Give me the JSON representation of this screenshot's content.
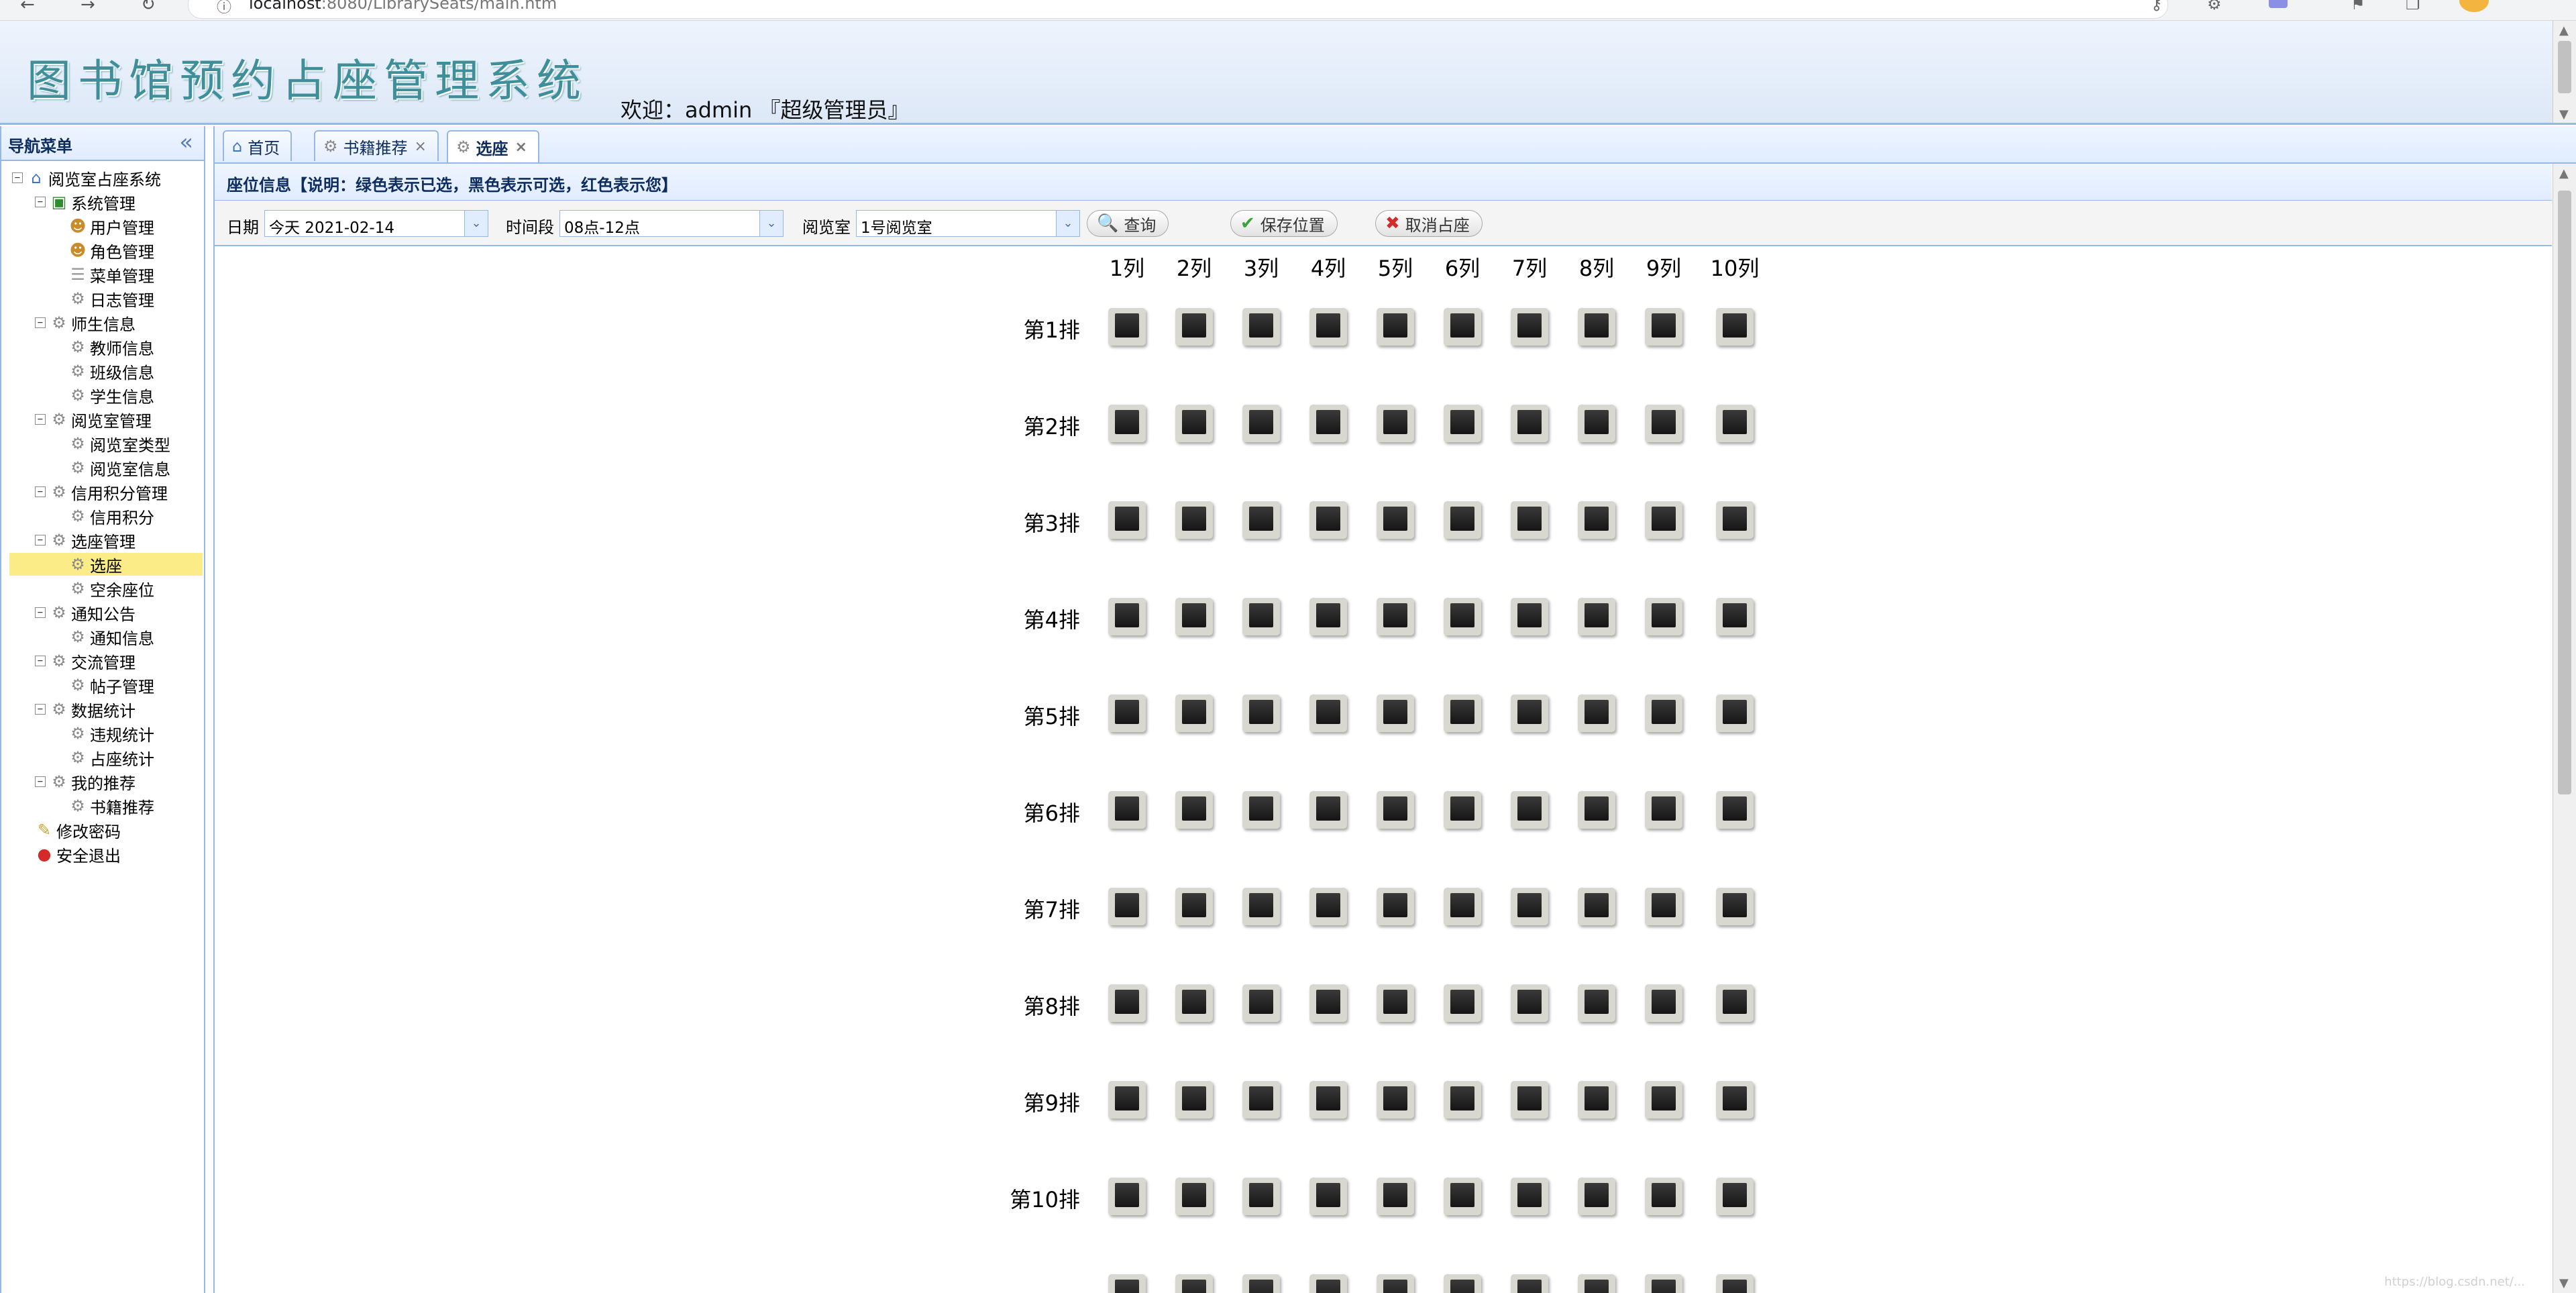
{
  "browser": {
    "back": "←",
    "forward": "→",
    "reload": "↻",
    "url_host": "localhost",
    "url_rest": ":8080/LibrarySeats/main.htm"
  },
  "header": {
    "title": "图书馆预约占座管理系统",
    "welcome": "欢迎：admin 『超级管理员』"
  },
  "sidebar": {
    "title": "导航菜单",
    "collapse_glyph": "«",
    "nodes": [
      {
        "label": "阅览室占座系统",
        "level": 0,
        "toggle": "⊟",
        "icon": "home-icon",
        "glyph": "⌂"
      },
      {
        "label": "系统管理",
        "level": 1,
        "toggle": "⊟",
        "icon": "system-icon",
        "glyph": "▣"
      },
      {
        "label": "用户管理",
        "level": 2,
        "icon": "user-icon",
        "glyph": "☻"
      },
      {
        "label": "角色管理",
        "level": 2,
        "icon": "role-icon",
        "glyph": "☻"
      },
      {
        "label": "菜单管理",
        "level": 2,
        "icon": "menu-icon",
        "glyph": "☰"
      },
      {
        "label": "日志管理",
        "level": 2,
        "icon": "gear-icon",
        "glyph": "⚙"
      },
      {
        "label": "师生信息",
        "level": 1,
        "toggle": "⊟",
        "icon": "gear-icon",
        "glyph": "⚙"
      },
      {
        "label": "教师信息",
        "level": 2,
        "icon": "gear-icon",
        "glyph": "⚙"
      },
      {
        "label": "班级信息",
        "level": 2,
        "icon": "gear-icon",
        "glyph": "⚙"
      },
      {
        "label": "学生信息",
        "level": 2,
        "icon": "gear-icon",
        "glyph": "⚙"
      },
      {
        "label": "阅览室管理",
        "level": 1,
        "toggle": "⊟",
        "icon": "gear-icon",
        "glyph": "⚙"
      },
      {
        "label": "阅览室类型",
        "level": 2,
        "icon": "gear-icon",
        "glyph": "⚙"
      },
      {
        "label": "阅览室信息",
        "level": 2,
        "icon": "gear-icon",
        "glyph": "⚙"
      },
      {
        "label": "信用积分管理",
        "level": 1,
        "toggle": "⊟",
        "icon": "gear-icon",
        "glyph": "⚙"
      },
      {
        "label": "信用积分",
        "level": 2,
        "icon": "gear-icon",
        "glyph": "⚙"
      },
      {
        "label": "选座管理",
        "level": 1,
        "toggle": "⊟",
        "icon": "gear-icon",
        "glyph": "⚙"
      },
      {
        "label": "选座",
        "level": 2,
        "icon": "gear-icon",
        "glyph": "⚙",
        "selected": true
      },
      {
        "label": "空余座位",
        "level": 2,
        "icon": "gear-icon",
        "glyph": "⚙"
      },
      {
        "label": "通知公告",
        "level": 1,
        "toggle": "⊟",
        "icon": "gear-icon",
        "glyph": "⚙"
      },
      {
        "label": "通知信息",
        "level": 2,
        "icon": "gear-icon",
        "glyph": "⚙"
      },
      {
        "label": "交流管理",
        "level": 1,
        "toggle": "⊟",
        "icon": "gear-icon",
        "glyph": "⚙"
      },
      {
        "label": "帖子管理",
        "level": 2,
        "icon": "gear-icon",
        "glyph": "⚙"
      },
      {
        "label": "数据统计",
        "level": 1,
        "toggle": "⊟",
        "icon": "gear-icon",
        "glyph": "⚙"
      },
      {
        "label": "违规统计",
        "level": 2,
        "icon": "gear-icon",
        "glyph": "⚙"
      },
      {
        "label": "占座统计",
        "level": 2,
        "icon": "gear-icon",
        "glyph": "⚙"
      },
      {
        "label": "我的推荐",
        "level": 1,
        "toggle": "⊟",
        "icon": "gear-icon",
        "glyph": "⚙"
      },
      {
        "label": "书籍推荐",
        "level": 2,
        "icon": "gear-icon",
        "glyph": "⚙"
      },
      {
        "label": "修改密码",
        "level": 1,
        "icon": "key-icon",
        "glyph": "✎"
      },
      {
        "label": "安全退出",
        "level": 1,
        "icon": "exit-icon",
        "glyph": "●"
      }
    ]
  },
  "tabs": [
    {
      "label": "首页",
      "icon": "home-icon",
      "glyph": "⌂",
      "closable": false,
      "active": false
    },
    {
      "label": "书籍推荐",
      "icon": "gear-icon",
      "glyph": "⚙",
      "closable": true,
      "active": false
    },
    {
      "label": "选座",
      "icon": "gear-icon",
      "glyph": "⚙",
      "closable": true,
      "active": true
    }
  ],
  "tab_close_glyph": "×",
  "info_strip": "座位信息【说明：绿色表示已选，黑色表示可选，红色表示您】",
  "toolbar": {
    "date_label": "日期",
    "date_value": "今天  2021-02-14",
    "period_label": "时间段",
    "period_value": "08点-12点",
    "room_label": "阅览室",
    "room_value": "1号阅览室",
    "dropdown_glyph": "⌄",
    "query_button": "查询",
    "save_button": "保存位置",
    "cancel_button": "取消占座",
    "search_glyph": "🔍",
    "check_glyph": "✔",
    "x_glyph": "✖"
  },
  "seats": {
    "columns": [
      "1列",
      "2列",
      "3列",
      "4列",
      "5列",
      "6列",
      "7列",
      "8列",
      "9列",
      "10列"
    ],
    "rows": [
      "第1排",
      "第2排",
      "第3排",
      "第4排",
      "第5排",
      "第6排",
      "第7排",
      "第8排",
      "第9排",
      "第10排"
    ],
    "status": "available",
    "legend_colors": {
      "selected": "#2fa52f",
      "available": "#1a1a1a",
      "mine": "#d42a2a"
    }
  },
  "watermark": "https://blog.csdn.net/..."
}
